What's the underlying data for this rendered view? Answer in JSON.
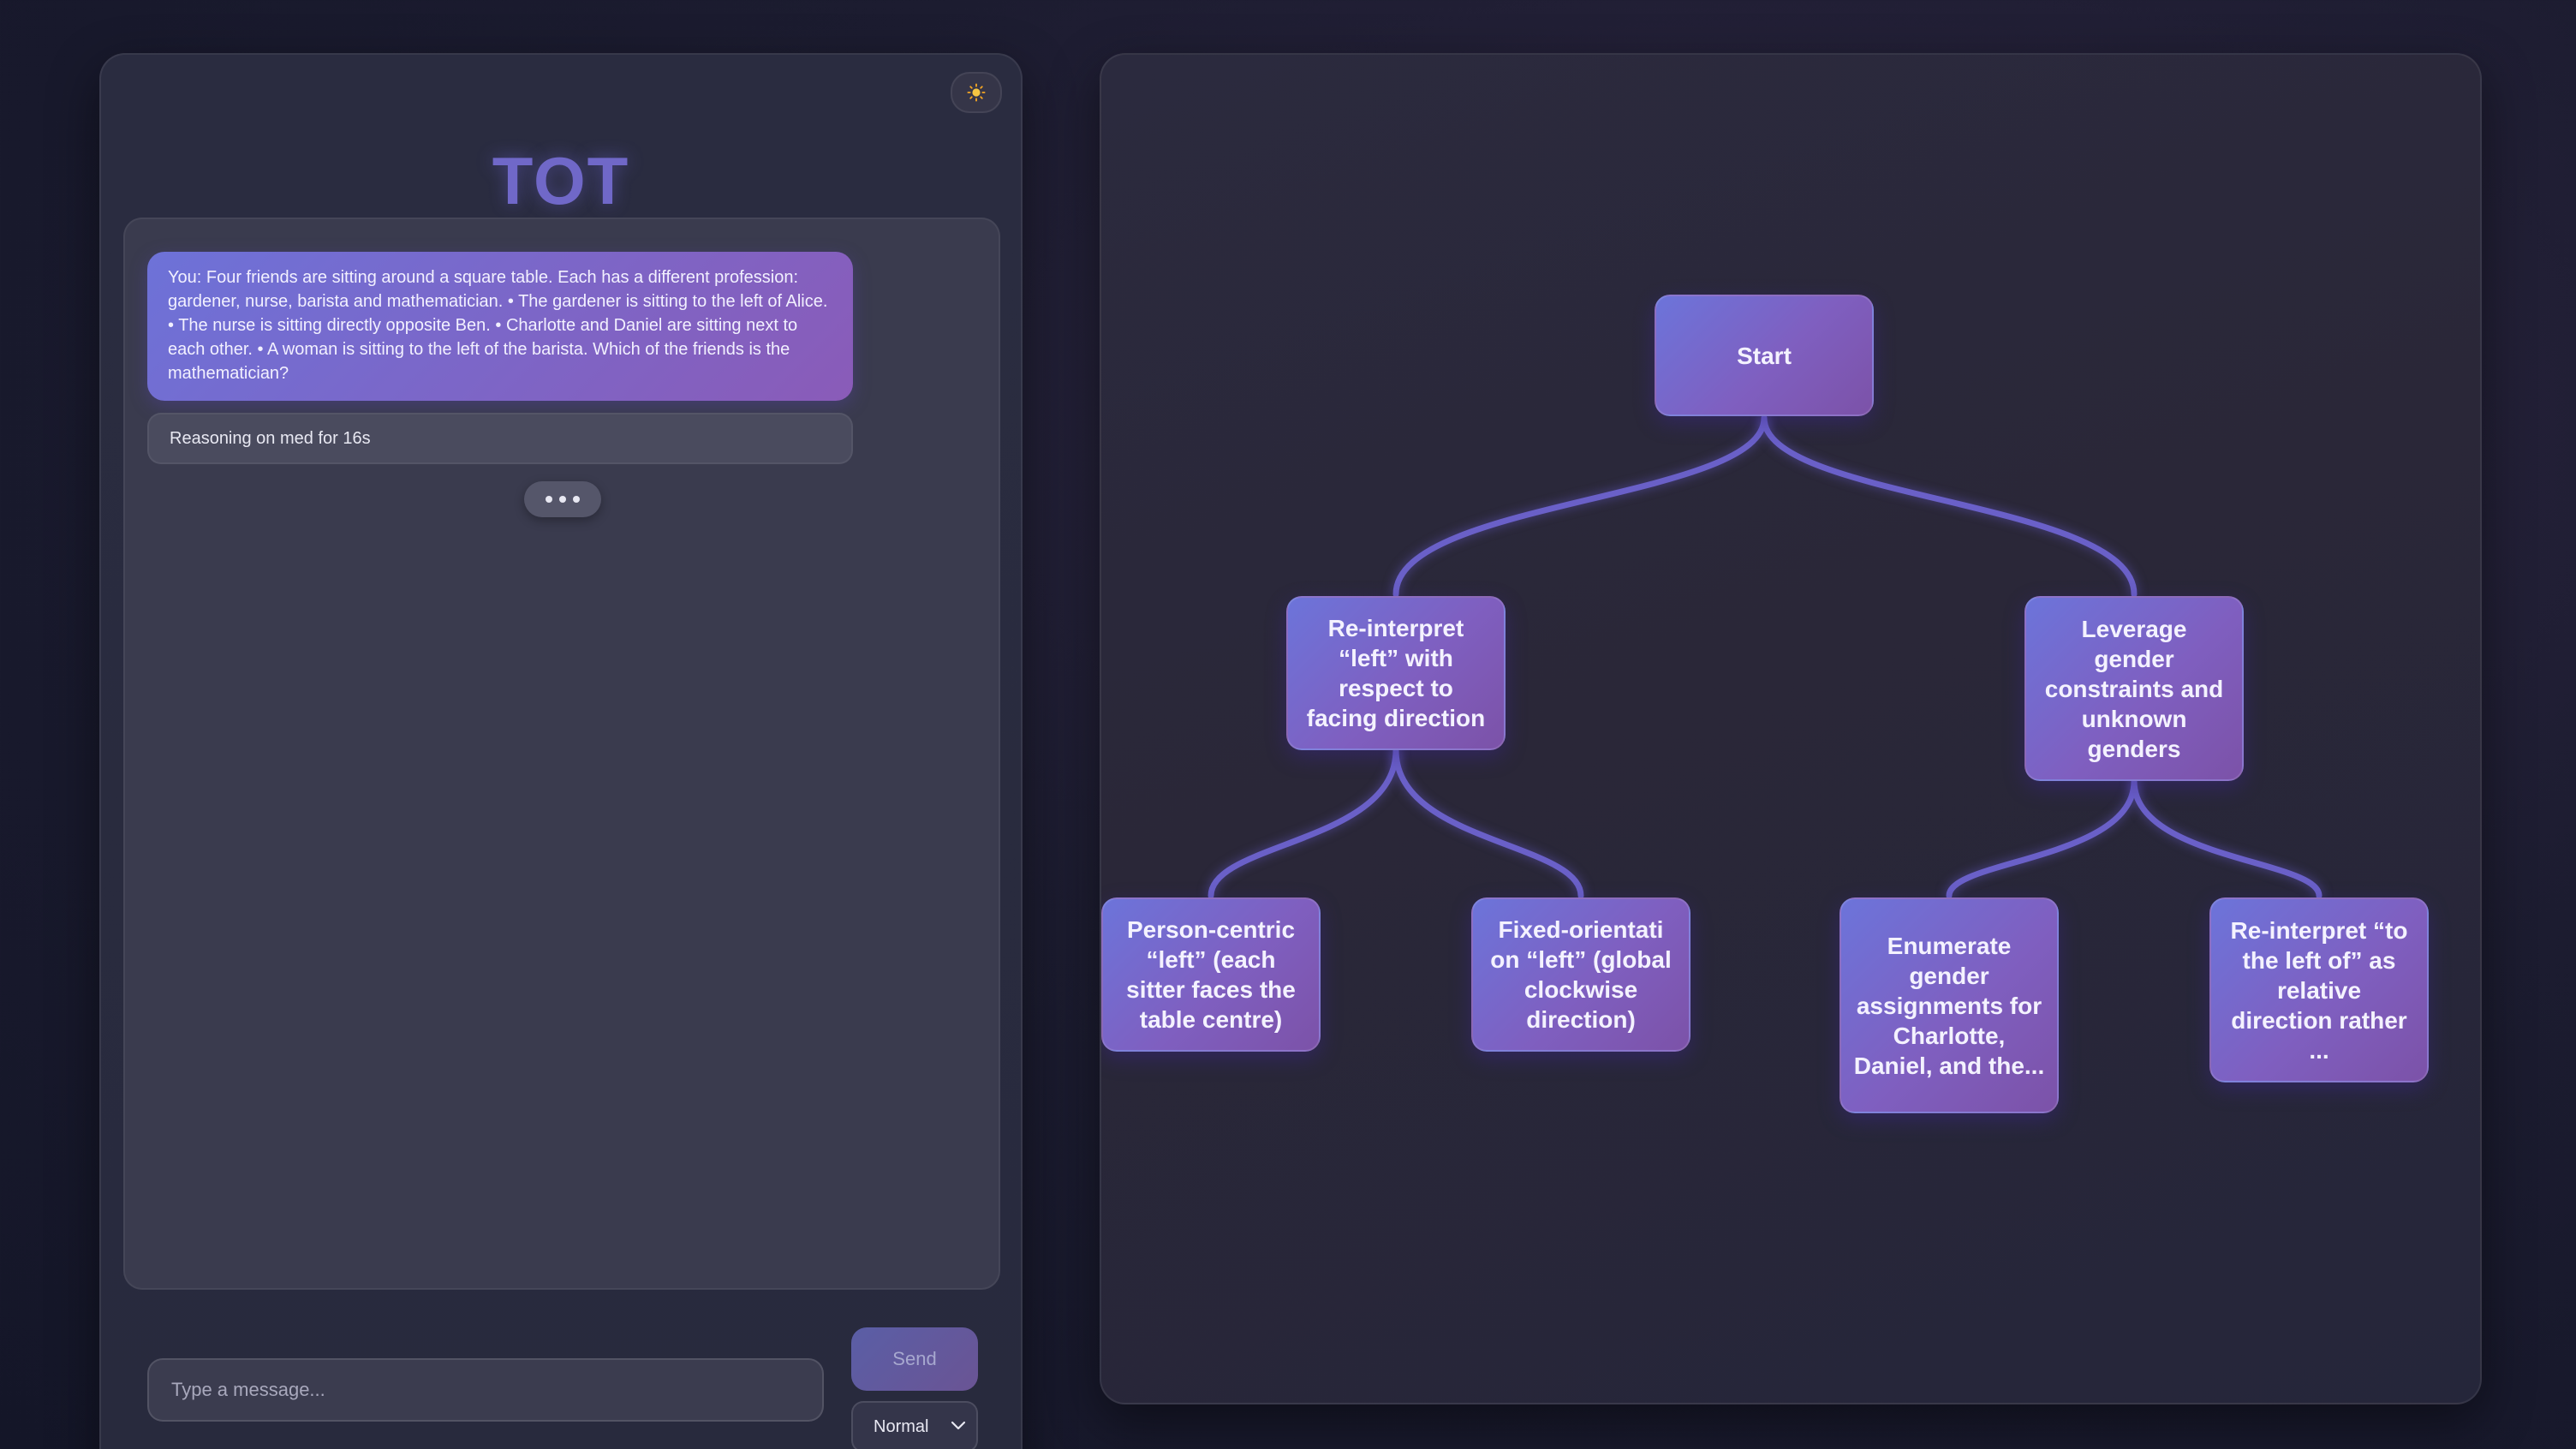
{
  "app": {
    "title": "TOT",
    "theme_toggle_icon": "sun-icon"
  },
  "chat": {
    "messages": [
      {
        "role": "user",
        "text": "You: Four friends are sitting around a square table. Each has a different profession: gardener, nurse, barista and mathematician. • The gardener is sitting to the left of Alice. • The nurse is sitting directly opposite Ben. • Charlotte and Daniel are sitting next to each other. • A woman is sitting to the left of the barista. Which of the friends is the mathematician?"
      },
      {
        "role": "status",
        "text": "Reasoning on med for 16s"
      }
    ],
    "typing_indicator": "•••"
  },
  "composer": {
    "placeholder": "Type a message...",
    "value": "",
    "send_label": "Send",
    "mode_selected": "Normal"
  },
  "tree": {
    "nodes": [
      {
        "id": "start",
        "label": "Start"
      },
      {
        "id": "a",
        "label": "Re-interpret “left” with respect to facing direction"
      },
      {
        "id": "b",
        "label": "Leverage gender constraints and unknown genders"
      },
      {
        "id": "a1",
        "label": "Person-centric “left” (each sitter faces the table centre)"
      },
      {
        "id": "a2",
        "label": "Fixed-orientati on “left” (global clockwise direction)"
      },
      {
        "id": "b1",
        "label": "Enumerate gender assignments for Charlotte, Daniel, and the..."
      },
      {
        "id": "b2",
        "label": "Re-interpret “to the left of” as relative direction rather ..."
      }
    ],
    "edges": [
      {
        "from": "start",
        "to": "a"
      },
      {
        "from": "start",
        "to": "b"
      },
      {
        "from": "a",
        "to": "a1"
      },
      {
        "from": "a",
        "to": "a2"
      },
      {
        "from": "b",
        "to": "b1"
      },
      {
        "from": "b",
        "to": "b2"
      }
    ],
    "colors": {
      "edge": "#6a60c8",
      "node_gradient_start": "#6c74da",
      "node_gradient_end": "#7c52a8"
    }
  }
}
